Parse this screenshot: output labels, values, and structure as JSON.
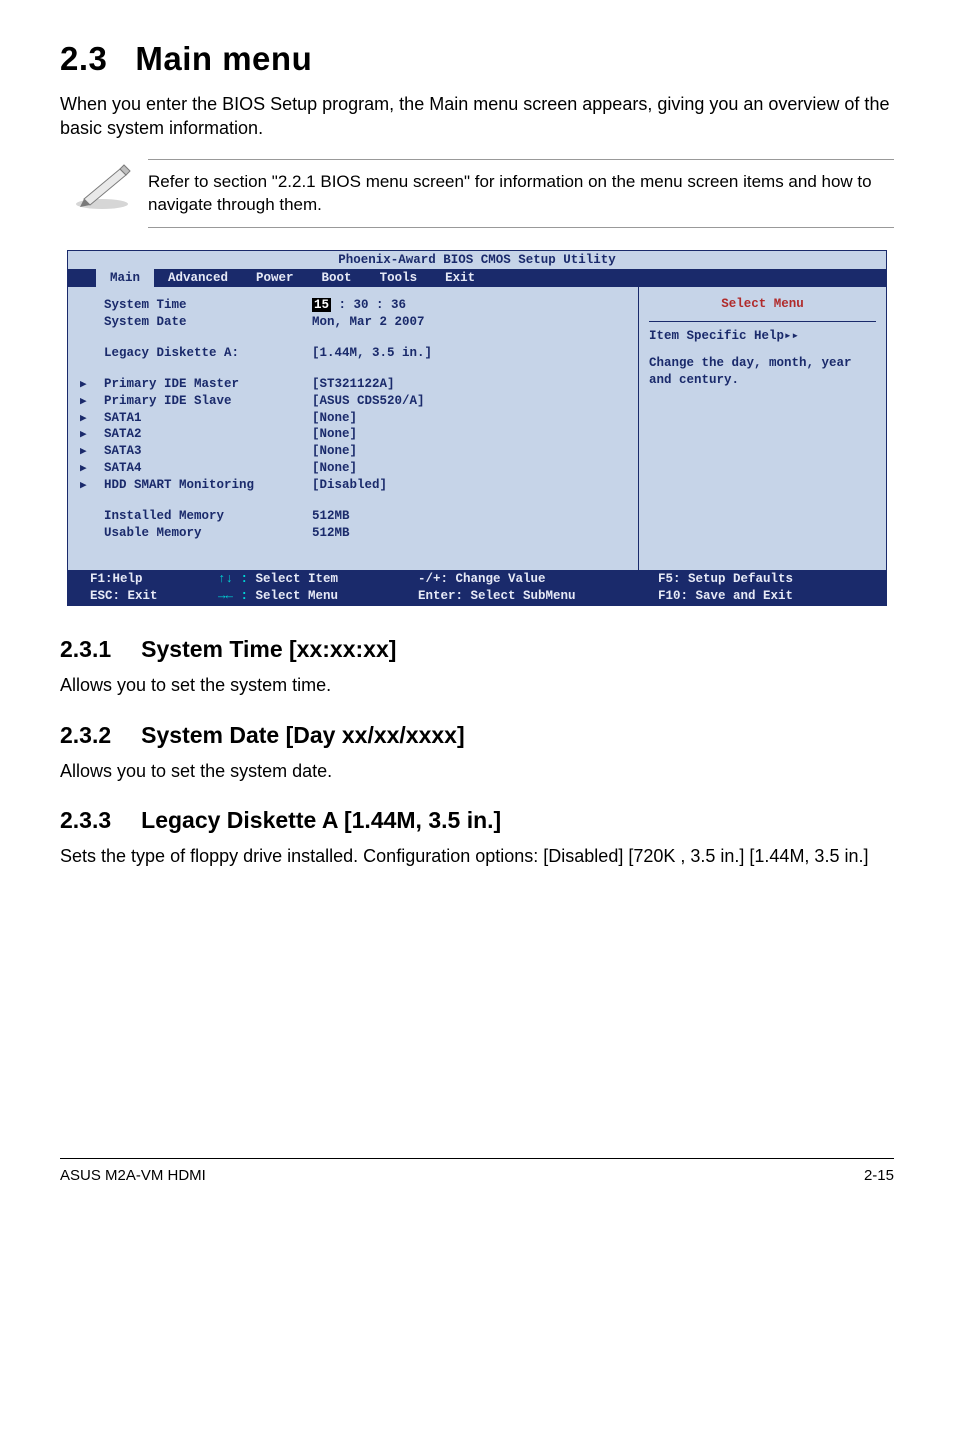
{
  "section": {
    "num": "2.3",
    "title": "Main menu"
  },
  "intro": "When you enter the BIOS Setup program, the Main menu screen appears, giving you an overview of the basic system information.",
  "note": "Refer to section \"2.2.1  BIOS menu screen\" for information on the menu screen items and how to navigate through them.",
  "bios": {
    "title": "Phoenix-Award BIOS CMOS Setup Utility",
    "tabs": [
      "Main",
      "Advanced",
      "Power",
      "Boot",
      "Tools",
      "Exit"
    ],
    "help_panel": {
      "select_menu": "Select Menu",
      "item_help_label": "Item Specific Help",
      "help_text": "Change the day, month, year and century."
    },
    "rows": {
      "system_time_lbl": "System Time",
      "system_time_hl": "15",
      "system_time_rest": " : 30 : 36",
      "system_date_lbl": "System Date",
      "system_date_val": "Mon, Mar 2  2007",
      "legacy_lbl": "Legacy Diskette A:",
      "legacy_val": "[1.44M, 3.5 in.]",
      "pim_lbl": "Primary IDE Master",
      "pim_val": "[ST321122A]",
      "pis_lbl": "Primary IDE Slave",
      "pis_val": "[ASUS CDS520/A]",
      "s1_lbl": "SATA1",
      "s1_val": "[None]",
      "s2_lbl": "SATA2",
      "s2_val": "[None]",
      "s3_lbl": "SATA3",
      "s3_val": "[None]",
      "s4_lbl": "SATA4",
      "s4_val": "[None]",
      "hdd_lbl": "HDD SMART Monitoring",
      "hdd_val": "[Disabled]",
      "inst_lbl": "Installed Memory",
      "inst_val": "512MB",
      "usable_lbl": "Usable Memory",
      "usable_val": "512MB"
    },
    "footer": {
      "a1": "F1:Help",
      "a2": "ESC: Exit",
      "b1_arrow": "↑↓ :",
      "b1_txt": " Select Item",
      "b2_arrow": "→← :",
      "b2_txt": " Select Menu",
      "c1": "-/+: Change Value",
      "c2": "Enter: Select SubMenu",
      "d1": "F5: Setup Defaults",
      "d2": "F10: Save and Exit"
    }
  },
  "sub": [
    {
      "num": "2.3.1",
      "title": "System Time [xx:xx:xx]",
      "body": "Allows you to set the system time."
    },
    {
      "num": "2.3.2",
      "title": "System Date [Day xx/xx/xxxx]",
      "body": "Allows you to set the system date."
    },
    {
      "num": "2.3.3",
      "title": "Legacy Diskette A [1.44M, 3.5 in.]",
      "body": "Sets the type of floppy drive installed. Configuration options: [Disabled] [720K , 3.5 in.] [1.44M, 3.5 in.]"
    }
  ],
  "footer": {
    "left": "ASUS M2A-VM HDMI",
    "right": "2-15"
  }
}
